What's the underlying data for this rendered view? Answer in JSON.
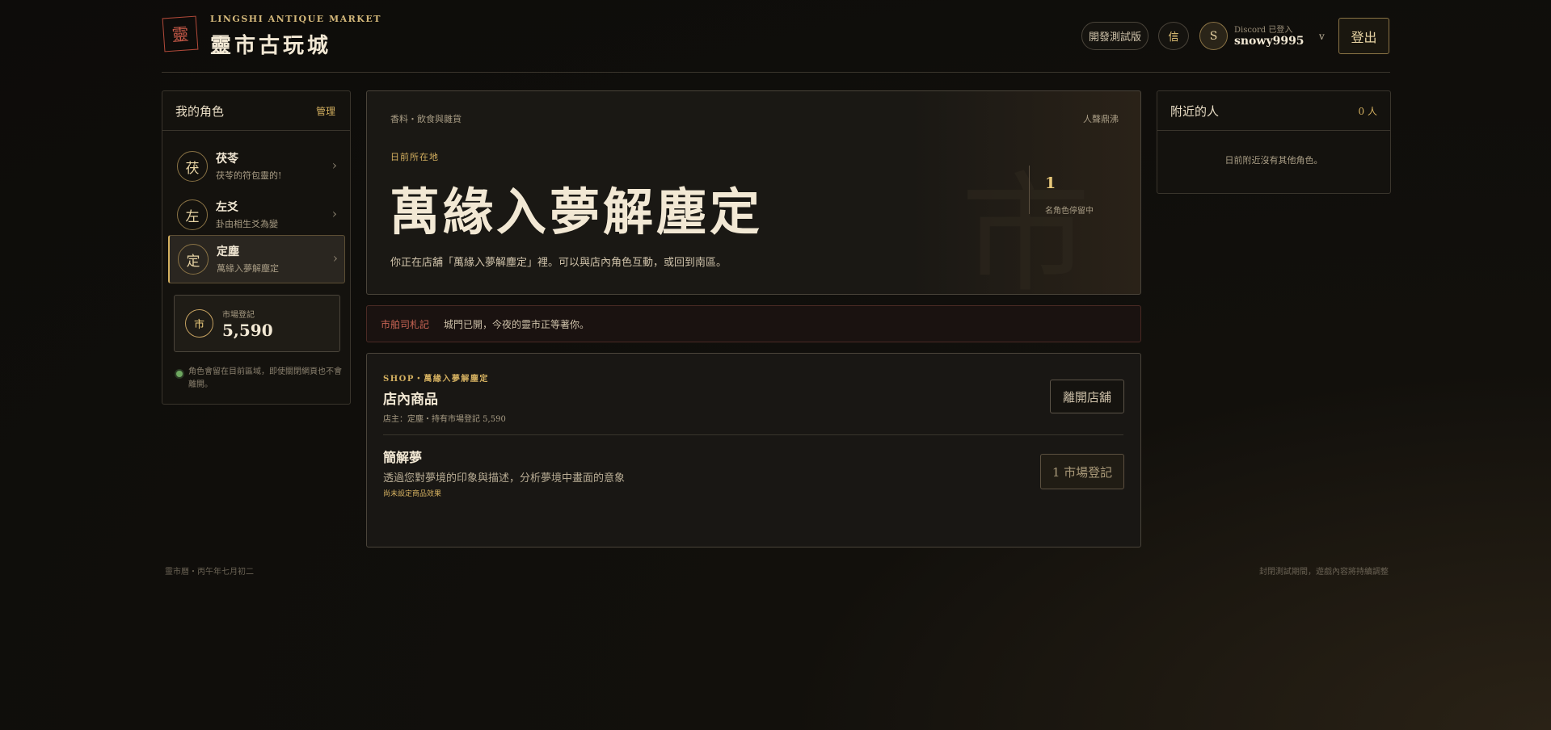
{
  "brand": {
    "seal": "靈",
    "en": "LINGSHI ANTIQUE MARKET",
    "zh": "靈市古玩城"
  },
  "header": {
    "beta_label": "開發測試版",
    "mail_label": "信",
    "avatar_letter": "S",
    "discord_status": "Discord 已登入",
    "username": "snowy9995",
    "caret": "v",
    "logout_label": "登出"
  },
  "left_panel": {
    "title": "我的角色",
    "manage_label": "管理",
    "characters": [
      {
        "glyph": "茯",
        "name": "茯苓",
        "sub": "茯苓的符包靈的!"
      },
      {
        "glyph": "左",
        "name": "左爻",
        "sub": "卦由相生爻為變"
      },
      {
        "glyph": "定",
        "name": "定塵",
        "sub": "萬緣入夢解塵定"
      }
    ],
    "currency": {
      "glyph": "市",
      "label": "市場登記",
      "value": "5,590"
    },
    "note": "角色會留在目前區域，即使關閉網頁也不會離開。"
  },
  "location": {
    "category": "香料・飲食與雜貨",
    "popularity": "人聲鼎沸",
    "label": "日前所在地",
    "name": "萬緣入夢解塵定",
    "description": "你正在店舖「萬緣入夢解塵定」裡。可以與店內角色互動，或回到南區。",
    "count": "1",
    "count_label": "名角色停留中",
    "watermark": "市"
  },
  "notice": {
    "tag": "市舶司札記",
    "text": "城門已開，今夜的靈市正等著你。"
  },
  "shop": {
    "tag": "SHOP・萬緣入夢解塵定",
    "title": "店內商品",
    "owner": "店主：定塵・持有市場登記 5,590",
    "leave_label": "離開店舖",
    "items": [
      {
        "name": "簡解夢",
        "desc": "透過您對夢境的印象與描述，分析夢境中畫面的意象",
        "note": "尚未設定商品效果",
        "price_label": "1 市場登記"
      }
    ]
  },
  "nearby": {
    "title": "附近的人",
    "count": "0 人",
    "empty": "日前附近沒有其他角色。"
  },
  "footer": {
    "left": "靈市曆・丙午年七月初二",
    "right": "封閉測試期間，遊戲內容將持續調整"
  }
}
